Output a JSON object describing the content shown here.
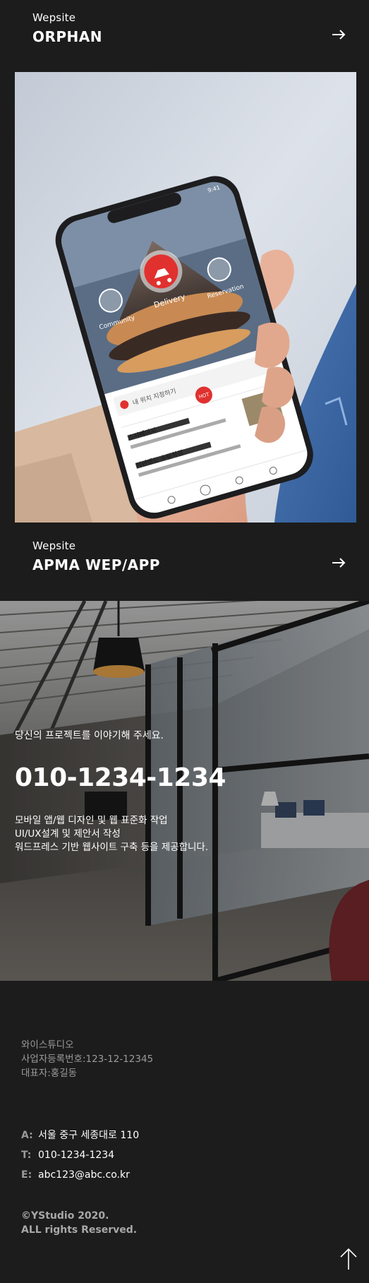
{
  "projects": [
    {
      "category": "Wepsite",
      "name": "ORPHAN",
      "arrow_icon": "arrow-right-icon"
    },
    {
      "category": "Wepsite",
      "name": "APMA WEP/APP",
      "arrow_icon": "arrow-right-icon"
    }
  ],
  "phone_app": {
    "menu": [
      "Community",
      "Delivery",
      "Reservation"
    ],
    "search_text": "내 위치 지정하기",
    "badge": "HOT",
    "stores": [
      {
        "name": "스시뻬이지",
        "meta": "★4.8  ₩1,200  ♥15"
      },
      {
        "name": "런던앤드 수림학점",
        "meta": "★4.6"
      }
    ],
    "status_time": "9:41"
  },
  "contact": {
    "lead": "당신의 프로젝트를 이야기해 주세요.",
    "phone": "010-1234-1234",
    "services": [
      "모바일 앱/웹 디자인 및 웹 표준화 작업",
      "UI/UX설계 및 제안서 작성",
      "워드프레스 기반 웹사이트 구축 등을 제공합니다."
    ]
  },
  "footer": {
    "company": "와이스튜디오",
    "registration": "사업자등록번호:123-12-12345",
    "ceo": "대표자:홍길동",
    "address_label": "A:",
    "address": "서울 중구 세종대로 110",
    "tel_label": "T:",
    "tel": "010-1234-1234",
    "email_label": "E:",
    "email": "abc123@abc.co.kr",
    "copyright_1": "©YStudio 2020.",
    "copyright_2": "ALL rights Reserved.",
    "top_icon": "arrow-up-icon"
  },
  "colors": {
    "background": "#1c1c1c",
    "brand_red": "#e0312f",
    "muted_text": "#9a9a9a"
  }
}
